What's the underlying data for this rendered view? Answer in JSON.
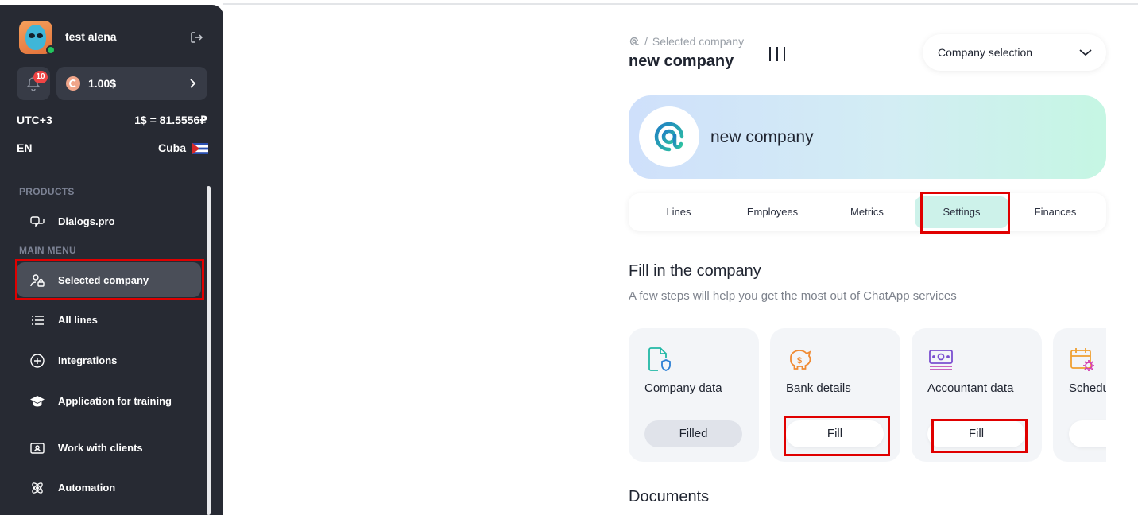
{
  "colors": {
    "sidebar_bg": "#272a33",
    "accent_active_tab": "#cdf2ea",
    "highlight_red": "#e00000",
    "online": "#22c55e",
    "badge": "#ef4444"
  },
  "sidebar": {
    "user_name": "test alena",
    "notifications_count": "10",
    "balance": "1.00$",
    "timezone": "UTC+3",
    "exchange_rate": "1$ = 81.5556₽",
    "language": "EN",
    "country": "Cuba",
    "products_label": "PRODUCTS",
    "main_menu_label": "MAIN MENU",
    "items": [
      {
        "label": "Dialogs.pro",
        "icon": "chat-bubbles-icon"
      },
      {
        "label": "Selected company",
        "icon": "user-lock-icon",
        "active": true
      },
      {
        "label": "All lines",
        "icon": "list-icon"
      },
      {
        "label": "Integrations",
        "icon": "plus-circle-icon"
      },
      {
        "label": "Application for training",
        "icon": "graduation-cap-icon"
      },
      {
        "label": "Work with clients",
        "icon": "id-card-icon"
      },
      {
        "label": "Automation",
        "icon": "atom-icon"
      }
    ]
  },
  "header": {
    "breadcrumb": "Selected company",
    "breadcrumb_separator": "/",
    "title": "new company",
    "company_select_label": "Company selection"
  },
  "hero": {
    "company_name": "new company"
  },
  "tabs": [
    {
      "label": "Lines"
    },
    {
      "label": "Employees"
    },
    {
      "label": "Metrics"
    },
    {
      "label": "Settings",
      "active": true
    },
    {
      "label": "Finances"
    }
  ],
  "fill_section": {
    "title": "Fill in the company",
    "subtitle": "A few steps will help you get the most out of ChatApp services",
    "cards": [
      {
        "title": "Company data",
        "button": "Filled",
        "icon": "document-shield-icon"
      },
      {
        "title": "Bank details",
        "button": "Fill",
        "icon": "piggy-bank-icon"
      },
      {
        "title": "Accountant data",
        "button": "Fill",
        "icon": "banknote-icon"
      },
      {
        "title": "Schedule",
        "button": "",
        "icon": "calendar-gear-icon"
      }
    ]
  },
  "documents_title": "Documents"
}
